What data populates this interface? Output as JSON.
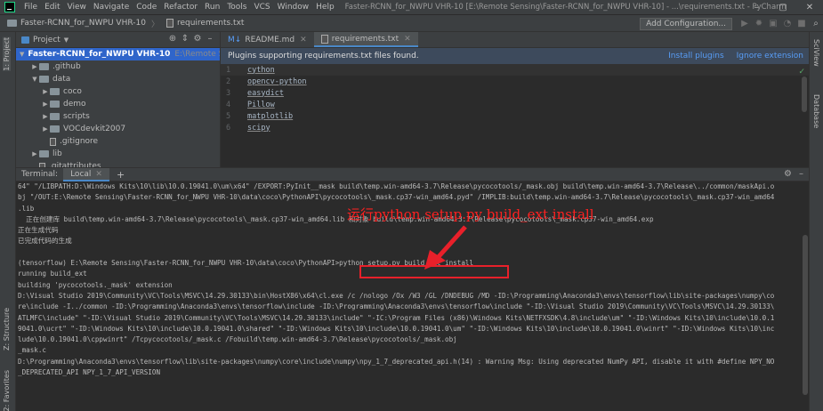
{
  "window": {
    "title": "Faster-RCNN_for_NWPU VHR-10 [E:\\Remote Sensing\\Faster-RCNN_for_NWPU VHR-10] - ...\\requirements.txt - PyCharm",
    "controls": [
      "–",
      "▢",
      "✕"
    ]
  },
  "menu": [
    "File",
    "Edit",
    "View",
    "Navigate",
    "Code",
    "Refactor",
    "Run",
    "Tools",
    "VCS",
    "Window",
    "Help"
  ],
  "breadcrumb": {
    "project": "Faster-RCNN_for_NWPU VHR-10",
    "file": "requirements.txt"
  },
  "toolbar": {
    "add_configuration": "Add Configuration..."
  },
  "left_strip": {
    "project_tab": "1: Project",
    "structure_tab": "Z: Structure",
    "favorites_tab": "2: Favorites"
  },
  "right_strip": {
    "sciview_tab": "SciView",
    "database_tab": "Database"
  },
  "project_panel": {
    "title": "Project",
    "tree": [
      {
        "label": "Faster-RCNN_for_NWPU VHR-10",
        "path": "E:\\Remote Sensi",
        "depth": 0,
        "expanded": true,
        "selected": true,
        "type": "folder"
      },
      {
        "label": ".github",
        "depth": 1,
        "expanded": false,
        "type": "folder"
      },
      {
        "label": "data",
        "depth": 1,
        "expanded": true,
        "type": "folder"
      },
      {
        "label": "coco",
        "depth": 2,
        "expanded": false,
        "type": "folder"
      },
      {
        "label": "demo",
        "depth": 2,
        "expanded": false,
        "type": "folder"
      },
      {
        "label": "scripts",
        "depth": 2,
        "expanded": false,
        "type": "folder"
      },
      {
        "label": "VOCdevkit2007",
        "depth": 2,
        "expanded": false,
        "type": "folder"
      },
      {
        "label": ".gitignore",
        "depth": 2,
        "type": "file"
      },
      {
        "label": "lib",
        "depth": 1,
        "expanded": false,
        "type": "folder"
      },
      {
        "label": ".gitattributes",
        "depth": 1,
        "type": "file"
      }
    ]
  },
  "editor": {
    "tabs": [
      {
        "label": "README.md",
        "active": false
      },
      {
        "label": "requirements.txt",
        "active": true
      }
    ],
    "banner": {
      "message": "Plugins supporting requirements.txt files found.",
      "install": "Install plugins",
      "ignore": "Ignore extension"
    },
    "lines": [
      {
        "num": "1",
        "text": "cython"
      },
      {
        "num": "2",
        "text": "opencv-python"
      },
      {
        "num": "3",
        "text": "easydict"
      },
      {
        "num": "4",
        "text": "Pillow"
      },
      {
        "num": "5",
        "text": "matplotlib"
      },
      {
        "num": "6",
        "text": "scipy"
      }
    ]
  },
  "terminal": {
    "label": "Terminal:",
    "tab": "Local",
    "plus": "+",
    "lines": [
      "64\" \"/LIBPATH:D:\\Windows Kits\\10\\lib\\10.0.19041.0\\um\\x64\" /EXPORT:PyInit__mask build\\temp.win-amd64-3.7\\Release\\pycocotools/_mask.obj build\\temp.win-amd64-3.7\\Release\\../common/maskApi.o",
      "bj \"/OUT:E:\\Remote Sensing\\Faster-RCNN_for_NWPU VHR-10\\data\\coco\\PythonAPI\\pycocotools\\_mask.cp37-win_amd64.pyd\" /IMPLIB:build\\temp.win-amd64-3.7\\Release\\pycocotools\\_mask.cp37-win_amd64",
      ".lib",
      "  正在创建库 build\\temp.win-amd64-3.7\\Release\\pycocotools\\_mask.cp37-win_amd64.lib 和对象 build\\temp.win-amd64-3.7\\Release\\pycocotools\\_mask.cp37-win_amd64.exp",
      "正在生成代码",
      "已完成代码的生成",
      "",
      "(tensorflow) E:\\Remote Sensing\\Faster-RCNN_for_NWPU VHR-10\\data\\coco\\PythonAPI>python setup.py build_ext install",
      "running build_ext",
      "building 'pycocotools._mask' extension",
      "D:\\Visual Studio 2019\\Community\\VC\\Tools\\MSVC\\14.29.30133\\bin\\HostX86\\x64\\cl.exe /c /nologo /Ox /W3 /GL /DNDEBUG /MD -ID:\\Programming\\Anaconda3\\envs\\tensorflow\\lib\\site-packages\\numpy\\co",
      "re\\include -I../common -ID:\\Programming\\Anaconda3\\envs\\tensorflow\\include -ID:\\Programming\\Anaconda3\\envs\\tensorflow\\include \"-ID:\\Visual Studio 2019\\Community\\VC\\Tools\\MSVC\\14.29.30133\\",
      "ATLMFC\\include\" \"-ID:\\Visual Studio 2019\\Community\\VC\\Tools\\MSVC\\14.29.30133\\include\" \"-IC:\\Program Files (x86)\\Windows Kits\\NETFXSDK\\4.8\\include\\um\" \"-ID:\\Windows Kits\\10\\include\\10.0.1",
      "9041.0\\ucrt\" \"-ID:\\Windows Kits\\10\\include\\10.0.19041.0\\shared\" \"-ID:\\Windows Kits\\10\\include\\10.0.19041.0\\um\" \"-ID:\\Windows Kits\\10\\include\\10.0.19041.0\\winrt\" \"-ID:\\Windows Kits\\10\\inc",
      "lude\\10.0.19041.0\\cppwinrt\" /Tcpycocotools/_mask.c /Fobuild\\temp.win-amd64-3.7\\Release\\pycocotools/_mask.obj",
      "_mask.c",
      "D:\\Programming\\Anaconda3\\envs\\tensorflow\\lib\\site-packages\\numpy\\core\\include\\numpy\\npy_1_7_deprecated_api.h(14) : Warning Msg: Using deprecated NumPy API, disable it with #define NPY_NO",
      "_DEPRECATED_API NPY_1_7_API_VERSION"
    ],
    "annotation": "运行python setup.py build_ext install",
    "annotation_color": "#ff2020"
  },
  "colors": {
    "accent": "#4a88c7",
    "selection": "#2f65ca",
    "highlight_box": "#e8202a"
  }
}
